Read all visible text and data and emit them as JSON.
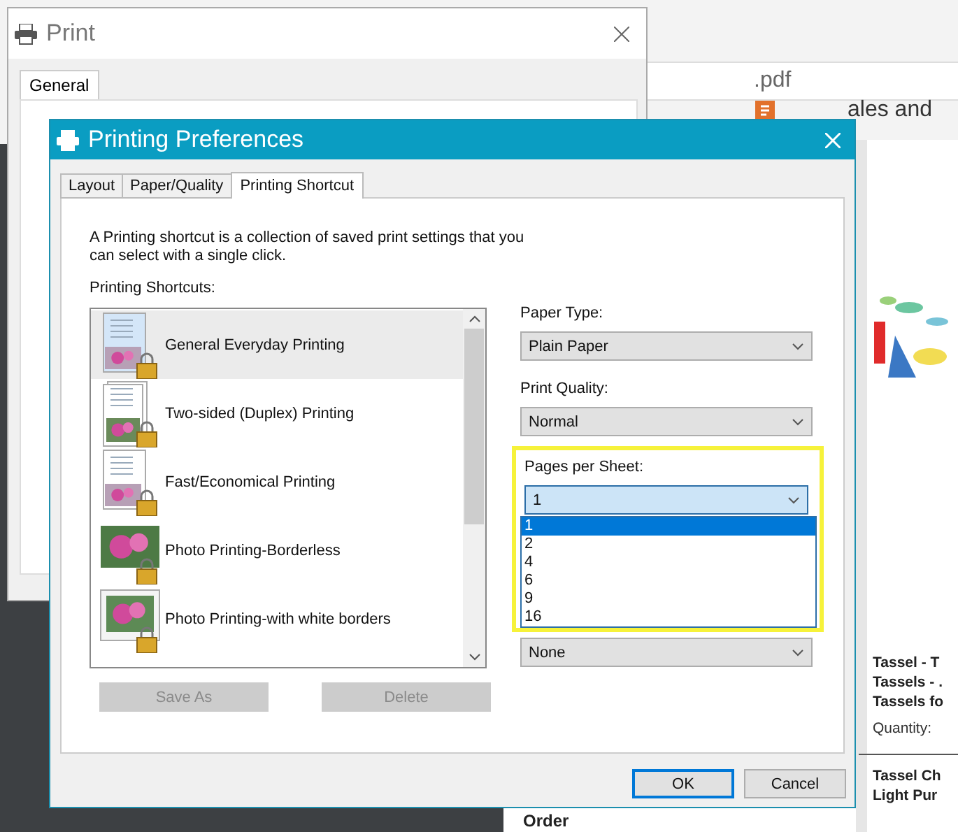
{
  "browser": {
    "file_name": ".pdf",
    "bookmark": "ales and",
    "document": {
      "items": [
        "Tassel - T",
        "Tassels - .",
        "Tassels fo"
      ],
      "quantity": "Quantity:",
      "items_2": [
        "Tassel Ch",
        "Light Pur"
      ],
      "footer": "Order"
    }
  },
  "print_window": {
    "title": "Print",
    "tabs": [
      {
        "label": "General",
        "selected": true
      }
    ]
  },
  "dialog": {
    "title": "Printing Preferences",
    "tabs": [
      {
        "label": "Layout",
        "selected": false
      },
      {
        "label": "Paper/Quality",
        "selected": false
      },
      {
        "label": "Printing Shortcut",
        "selected": true
      }
    ],
    "description": "A Printing shortcut is a collection of saved print settings that you can select with a single click.",
    "list_label": "Printing Shortcuts:",
    "shortcuts": [
      {
        "label": "General Everyday Printing",
        "kind": "document",
        "selected": true
      },
      {
        "label": "Two-sided (Duplex) Printing",
        "kind": "duplex",
        "selected": false
      },
      {
        "label": "Fast/Economical Printing",
        "kind": "document",
        "selected": false
      },
      {
        "label": "Photo Printing-Borderless",
        "selected": false
      },
      {
        "label": "Photo Printing-with white borders",
        "kind": "bordered",
        "selected": false
      }
    ],
    "list_buttons": [
      {
        "label": "Save As",
        "disabled": true
      },
      {
        "label": "Delete",
        "disabled": true
      }
    ],
    "settings": [
      {
        "label": "Paper Type:",
        "value": "Plain Paper"
      },
      {
        "label": "Print Quality:",
        "value": "Normal"
      }
    ],
    "pages_per_sheet": {
      "label": "Pages per Sheet:",
      "value": "1",
      "highlighted": true,
      "expanded": true,
      "options": [
        {
          "label": "1",
          "selected": true
        },
        {
          "label": "2",
          "selected": false
        },
        {
          "label": "4",
          "selected": false
        },
        {
          "label": "6",
          "selected": false
        },
        {
          "label": "9",
          "selected": false
        },
        {
          "label": "16",
          "selected": false
        }
      ]
    },
    "print_on_both_sides": {
      "value": "None"
    },
    "footer_buttons": [
      {
        "label": "OK",
        "default": true
      },
      {
        "label": "Cancel",
        "default": false
      }
    ]
  }
}
